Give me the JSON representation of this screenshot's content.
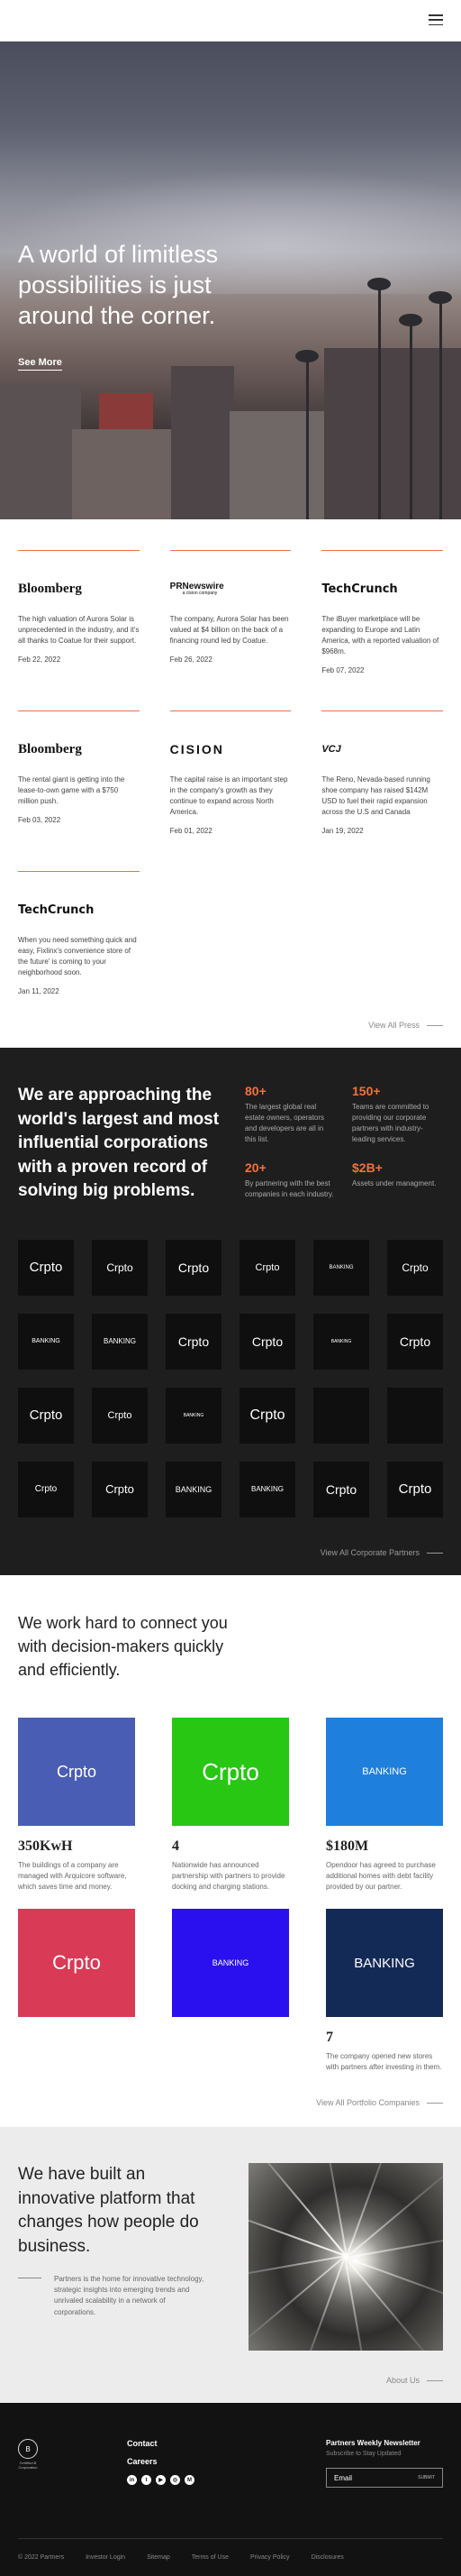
{
  "hero": {
    "headline": "A world of limitless possibilities is just around the corner.",
    "cta": "See More"
  },
  "press": {
    "items": [
      {
        "logo": "Bloomberg",
        "text": "The high valuation of Aurora Solar is unprecedented in the industry, and it's all thanks to Coatue for their support.",
        "date": "Feb 22, 2022"
      },
      {
        "logo": "PRNewswire",
        "logo_sub": "a cision company",
        "text": "The company, Aurora Solar has been valued at $4 billion on the back of a financing round led by Coatue.",
        "date": "Feb 26, 2022"
      },
      {
        "logo": "TechCrunch",
        "text": "The iBuyer marketplace will be expanding to Europe and Latin America, with a reported valuation of $968m.",
        "date": "Feb 07, 2022"
      },
      {
        "logo": "Bloomberg",
        "text": "The rental giant is getting into the lease-to-own game with a $750 million push.",
        "date": "Feb 03, 2022"
      },
      {
        "logo": "CISION",
        "text": "The capital raise is an important step in the company's growth as they continue to expand across North America.",
        "date": "Feb 01, 2022"
      },
      {
        "logo": "VCJ",
        "text": "The Reno, Nevada-based running shoe company has raised $142M USD to fuel their rapid expansion across the U.S and Canada",
        "date": "Jan 19, 2022"
      },
      {
        "logo": "TechCrunch",
        "text": "When you need something quick and easy, Fixlinx's convenience store of the future' is coming to your neighborhood soon.",
        "date": "Jan 11, 2022"
      }
    ],
    "view_all": "View All Press"
  },
  "corporate": {
    "headline": "We are approaching the world's largest and most influential corporations with a proven record of solving big problems.",
    "stats": [
      {
        "num": "80+",
        "text": "The largest global real estate owners, operators and developers are all in this list."
      },
      {
        "num": "150+",
        "text": "Teams are committed to providing our corporate partners with industry-leading services."
      },
      {
        "num": "20+",
        "text": "By partnering with the best companies in each industry."
      },
      {
        "num": "$2B+",
        "text": "Assets under managment."
      }
    ],
    "tiles": [
      {
        "label": "Crpto",
        "size": "15px"
      },
      {
        "label": "Crpto",
        "size": "12px"
      },
      {
        "label": "Crpto",
        "size": "14px"
      },
      {
        "label": "Crpto",
        "size": "11px"
      },
      {
        "label": "BANKING",
        "size": "6px"
      },
      {
        "label": "Crpto",
        "size": "12px"
      },
      {
        "label": "BANKING",
        "size": "7px"
      },
      {
        "label": "BANKING",
        "size": "8px"
      },
      {
        "label": "Crpto",
        "size": "14px"
      },
      {
        "label": "Crpto",
        "size": "14px"
      },
      {
        "label": "BANKING",
        "size": "5px"
      },
      {
        "label": "Crpto",
        "size": "14px"
      },
      {
        "label": "Crpto",
        "size": "15px"
      },
      {
        "label": "Crpto",
        "size": "11px"
      },
      {
        "label": "BANKING",
        "size": "5px"
      },
      {
        "label": "Crpto",
        "size": "16px"
      },
      {
        "label": "",
        "size": "10px"
      },
      {
        "label": "",
        "size": "10px"
      },
      {
        "label": "Crpto",
        "size": "10px"
      },
      {
        "label": "Crpto",
        "size": "13px"
      },
      {
        "label": "BANKING",
        "size": "9px"
      },
      {
        "label": "BANKING",
        "size": "8px"
      },
      {
        "label": "Crpto",
        "size": "14px"
      },
      {
        "label": "Crpto",
        "size": "15px"
      }
    ],
    "view_all": "View All Corporate Partners"
  },
  "portfolio": {
    "headline": "We work hard to connect you with decision-makers quickly and efficiently.",
    "items": [
      {
        "label": "Crpto",
        "color": "#4a5db4",
        "size": "18px",
        "value": "350KwH",
        "text": "The buildings of a company are managed with Arquicore software, which saves time and money."
      },
      {
        "label": "Crpto",
        "color": "#27c714",
        "size": "26px",
        "value": "4",
        "text": "Nationwide has announced partnership with partners to provide docking and charging stations."
      },
      {
        "label": "BANKING",
        "color": "#1e7fdc",
        "size": "11px",
        "value": "$180M",
        "text": "Opendoor has agreed to purchase additional homes with debt facility provided by our partner."
      },
      {
        "label": "Crpto",
        "color": "#d93a55",
        "size": "22px",
        "value": "",
        "text": ""
      },
      {
        "label": "BANKING",
        "color": "#2a10ee",
        "size": "9px",
        "value": "",
        "text": ""
      },
      {
        "label": "BANKING",
        "color": "#142a56",
        "size": "15px",
        "value": "7",
        "text": "The company opened new stores with partners after investing in them."
      }
    ],
    "view_all": "View All Portfolio Companies"
  },
  "platform": {
    "headline": "We have built an innovative platform that changes how people do business.",
    "sub": "Partners is the home for innovative technology, strategic insights into emerging trends and unrivaled scalability in a network of corporations.",
    "about": "About Us"
  },
  "footer": {
    "logo_caption": "Certified B Corporation",
    "nav": [
      "Contact",
      "Careers"
    ],
    "social_icons": [
      "linkedin-icon",
      "twitter-icon",
      "youtube-icon",
      "instagram-icon",
      "medium-icon"
    ],
    "newsletter_title": "Partners Weekly Newsletter",
    "newsletter_sub": "Subscribe to Stay Updated",
    "email_placeholder": "Email",
    "submit": "SUBMIT",
    "bottom_links": [
      "© 2022 Partners",
      "Investor Login",
      "Sitemap",
      "Terms of Use",
      "Privacy Policy",
      "Disclosures"
    ]
  },
  "colors": {
    "accent": "#f0723c",
    "dark": "#1e1e1e",
    "footer": "#121212"
  }
}
